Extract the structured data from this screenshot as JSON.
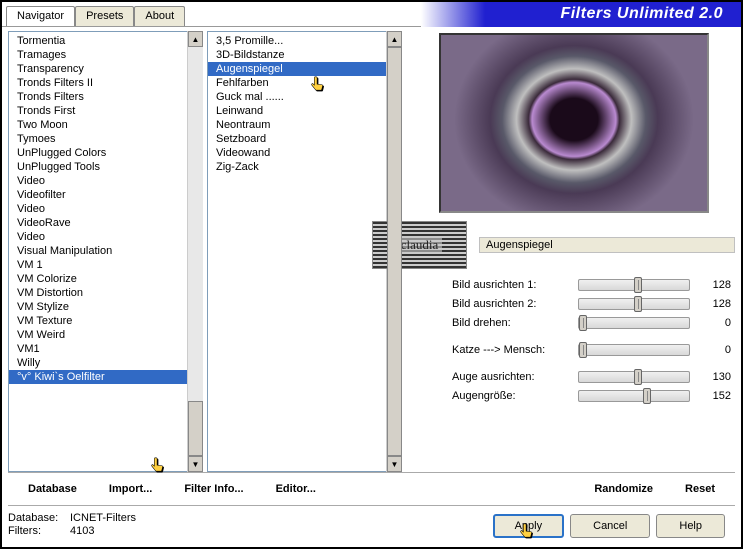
{
  "title": "Filters Unlimited 2.0",
  "tabs": [
    "Navigator",
    "Presets",
    "About"
  ],
  "leftList": [
    "Tormentia",
    "Tramages",
    "Transparency",
    "Tronds Filters II",
    "Tronds Filters",
    "Tronds First",
    "Two Moon",
    "Tymoes",
    "UnPlugged Colors",
    "UnPlugged Tools",
    "Video",
    "Videofilter",
    "Video",
    "VideoRave",
    "Video",
    "Visual Manipulation",
    "VM 1",
    "VM Colorize",
    "VM Distortion",
    "VM Stylize",
    "VM Texture",
    "VM Weird",
    "VM1",
    "Willy",
    "°v° Kiwi`s Oelfilter"
  ],
  "leftSelectedIndex": 24,
  "midList": [
    "3,5 Promille...",
    "3D-Bildstanze",
    "Augenspiegel",
    "Fehlfarben",
    "Guck mal ......",
    "Leinwand",
    "Neontraum",
    "Setzboard",
    "Videowand",
    "Zig-Zack"
  ],
  "midSelectedIndex": 2,
  "currentFilterName": "Augenspiegel",
  "params": [
    {
      "label": "Bild ausrichten 1:",
      "value": 128,
      "pos": 50
    },
    {
      "label": "Bild ausrichten 2:",
      "value": 128,
      "pos": 50
    },
    {
      "label": "Bild drehen:",
      "value": 0,
      "pos": 0
    }
  ],
  "params2": [
    {
      "label": "Katze ---> Mensch:",
      "value": 0,
      "pos": 0
    }
  ],
  "params3": [
    {
      "label": "Auge ausrichten:",
      "value": 130,
      "pos": 50
    },
    {
      "label": "Augengröße:",
      "value": 152,
      "pos": 58
    }
  ],
  "toolbar": [
    "Database",
    "Import...",
    "Filter Info...",
    "Editor..."
  ],
  "toolbarRight": [
    "Randomize",
    "Reset"
  ],
  "status": {
    "dbLabel": "Database:",
    "dbValue": "ICNET-Filters",
    "filtersLabel": "Filters:",
    "filtersValue": "4103"
  },
  "buttons": {
    "apply": "Apply",
    "cancel": "Cancel",
    "help": "Help"
  },
  "logoText": "claudia"
}
